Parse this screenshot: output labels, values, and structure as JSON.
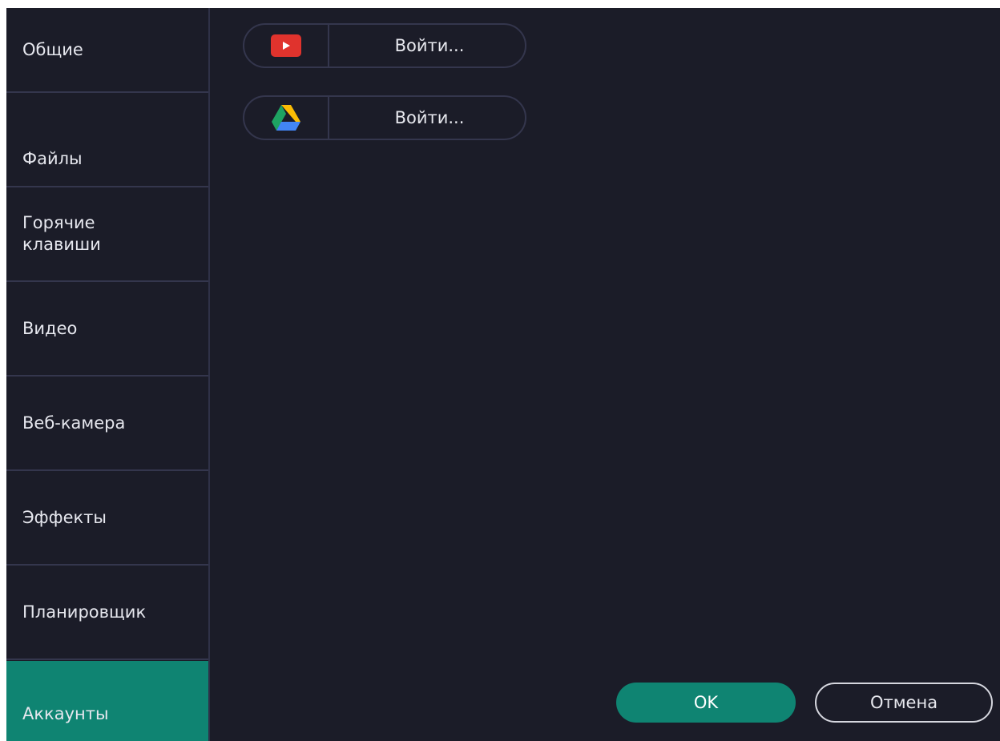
{
  "sidebar": {
    "items": [
      {
        "label": "Общие"
      },
      {
        "label": "Файлы"
      },
      {
        "label": "Горячие\nклавиши"
      },
      {
        "label": "Видео"
      },
      {
        "label": "Веб-камера"
      },
      {
        "label": "Эффекты"
      },
      {
        "label": "Планировщик"
      },
      {
        "label": "Аккаунты"
      }
    ],
    "active": "Аккаунты"
  },
  "accounts": [
    {
      "service_icon": "youtube-icon",
      "login_label": "Войти..."
    },
    {
      "service_icon": "google-drive-icon",
      "login_label": "Войти..."
    }
  ],
  "footer": {
    "ok_label": "OK",
    "cancel_label": "Отмена"
  },
  "colors": {
    "background": "#1b1c28",
    "accent": "#0f8472",
    "divider": "#34364d",
    "youtube_red": "#e0332d"
  }
}
